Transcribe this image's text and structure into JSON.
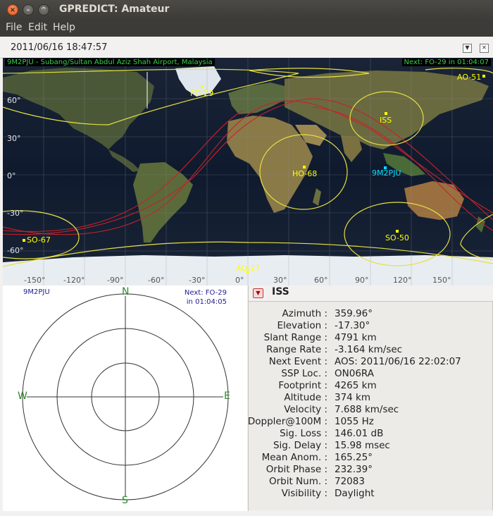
{
  "window": {
    "title": "GPREDICT: Amateur"
  },
  "menu": [
    "File",
    "Edit",
    "Help"
  ],
  "module": {
    "timestamp": "2011/06/16 18:47:57"
  },
  "map": {
    "qth_label": "9M2PJU - Subang/Sultan Abdul Aziz Shah Airport, Malaysia",
    "next_label": "Next: FO-29  in 01:04:07",
    "lat_labels": [
      "60°",
      "30°",
      "0°",
      "-30°",
      "-60°"
    ],
    "lon_labels": [
      "-150°",
      "-120°",
      "-90°",
      "-60°",
      "-30°",
      "0°",
      "30°",
      "60°",
      "90°",
      "120°",
      "150°"
    ],
    "satellites": [
      "AO-51",
      "FO-29",
      "ISS",
      "HO-68",
      "SO-67",
      "SO-50",
      "AO-27"
    ],
    "qth_name": "9M2PJU",
    "colors": {
      "sat": "#ffff00",
      "qth": "#00e0ff",
      "track": "#c8222a",
      "grid": "#8a8f9a",
      "label_green": "#39d24a"
    }
  },
  "polar": {
    "qth": "9M2PJU",
    "next_line1": "Next: FO-29",
    "next_line2": "in 01:04:05",
    "dirs": {
      "n": "N",
      "s": "S",
      "e": "E",
      "w": "W"
    }
  },
  "single": {
    "name": "ISS",
    "rows": [
      {
        "label": "Azimuth :",
        "value": "359.96°"
      },
      {
        "label": "Elevation :",
        "value": "-17.30°"
      },
      {
        "label": "Slant Range :",
        "value": "4791 km"
      },
      {
        "label": "Range Rate :",
        "value": "-3.164 km/sec"
      },
      {
        "label": "Next Event :",
        "value": "AOS: 2011/06/16 22:02:07"
      },
      {
        "label": "SSP Loc. :",
        "value": "ON06RA"
      },
      {
        "label": "Footprint :",
        "value": "4265 km"
      },
      {
        "label": "Altitude :",
        "value": "374 km"
      },
      {
        "label": "Velocity :",
        "value": "7.688 km/sec"
      },
      {
        "label": "Doppler@100M :",
        "value": "1055 Hz"
      },
      {
        "label": "Sig. Loss :",
        "value": "146.01 dB"
      },
      {
        "label": "Sig. Delay :",
        "value": "15.98 msec"
      },
      {
        "label": "Mean Anom. :",
        "value": "165.25°"
      },
      {
        "label": "Orbit Phase :",
        "value": "232.39°"
      },
      {
        "label": "Orbit Num. :",
        "value": "72083"
      },
      {
        "label": "Visibility :",
        "value": "Daylight"
      }
    ]
  }
}
